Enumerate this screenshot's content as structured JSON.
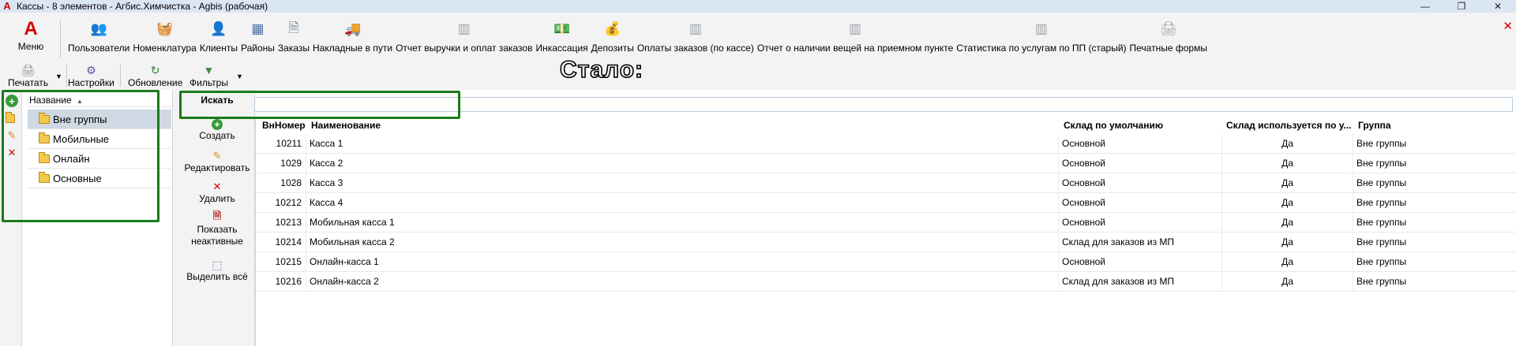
{
  "window": {
    "title": "Кассы - 8 элементов - Агбис.Химчистка - Agbis (рабочая)",
    "minimize_glyph": "—",
    "maximize_glyph": "❐",
    "close_glyph": "✕"
  },
  "ribbon": {
    "menu_label": "Меню",
    "items": [
      {
        "label": "Пользователи",
        "icon": "users-icon"
      },
      {
        "label": "Номенклатура",
        "icon": "basket-icon"
      },
      {
        "label": "Клиенты",
        "icon": "client-icon"
      },
      {
        "label": "Районы",
        "icon": "districts-icon"
      },
      {
        "label": "Заказы",
        "icon": "orders-icon"
      },
      {
        "label": "Накладные в пути",
        "icon": "truck-icon"
      },
      {
        "label": "Отчет выручки и оплат заказов",
        "icon": "report-icon"
      },
      {
        "label": "Инкассация",
        "icon": "money-icon"
      },
      {
        "label": "Депозиты",
        "icon": "deposit-icon"
      },
      {
        "label": "Оплаты заказов (по кассе)",
        "icon": "report-icon"
      },
      {
        "label": "Отчет о наличии вещей на приемном пункте",
        "icon": "report-icon"
      },
      {
        "label": "Статистика по услугам по ПП (старый)",
        "icon": "report-icon"
      },
      {
        "label": "Печатные формы",
        "icon": "printer-icon"
      }
    ]
  },
  "toolbar": {
    "print_label": "Печатать",
    "settings_label": "Настройки",
    "refresh_label": "Обновление",
    "filters_label": "Фильтры"
  },
  "annotation_text": "Стало:",
  "tree": {
    "header": "Название",
    "items": [
      "Вне группы",
      "Мобильные",
      "Онлайн",
      "Основные"
    ]
  },
  "actions": {
    "search_label": "Искать",
    "create": "Создать",
    "edit": "Редактировать",
    "delete": "Удалить",
    "show_inactive": "Показать неактивные",
    "select_all": "Выделить всё"
  },
  "search": {
    "value": "",
    "placeholder": ""
  },
  "table": {
    "columns": [
      "ВнНомер",
      "Наименование",
      "Склад по умолчанию",
      "Склад используется по у...",
      "Группа"
    ],
    "rows": [
      [
        "10211",
        "Касса 1",
        "Основной",
        "Да",
        "Вне группы"
      ],
      [
        "1029",
        "Касса 2",
        "Основной",
        "Да",
        "Вне группы"
      ],
      [
        "1028",
        "Касса 3",
        "Основной",
        "Да",
        "Вне группы"
      ],
      [
        "10212",
        "Касса 4",
        "Основной",
        "Да",
        "Вне группы"
      ],
      [
        "10213",
        "Мобильная касса 1",
        "Основной",
        "Да",
        "Вне группы"
      ],
      [
        "10214",
        "Мобильная касса 2",
        "Склад для заказов из МП",
        "Да",
        "Вне группы"
      ],
      [
        "10215",
        "Онлайн-касса 1",
        "Основной",
        "Да",
        "Вне группы"
      ],
      [
        "10216",
        "Онлайн-касса 2",
        "Склад для заказов из МП",
        "Да",
        "Вне группы"
      ]
    ]
  },
  "colors": {
    "highlight": "#1a7a1a",
    "brand_red": "#d40000",
    "selected_row": "#cfd8e3"
  }
}
